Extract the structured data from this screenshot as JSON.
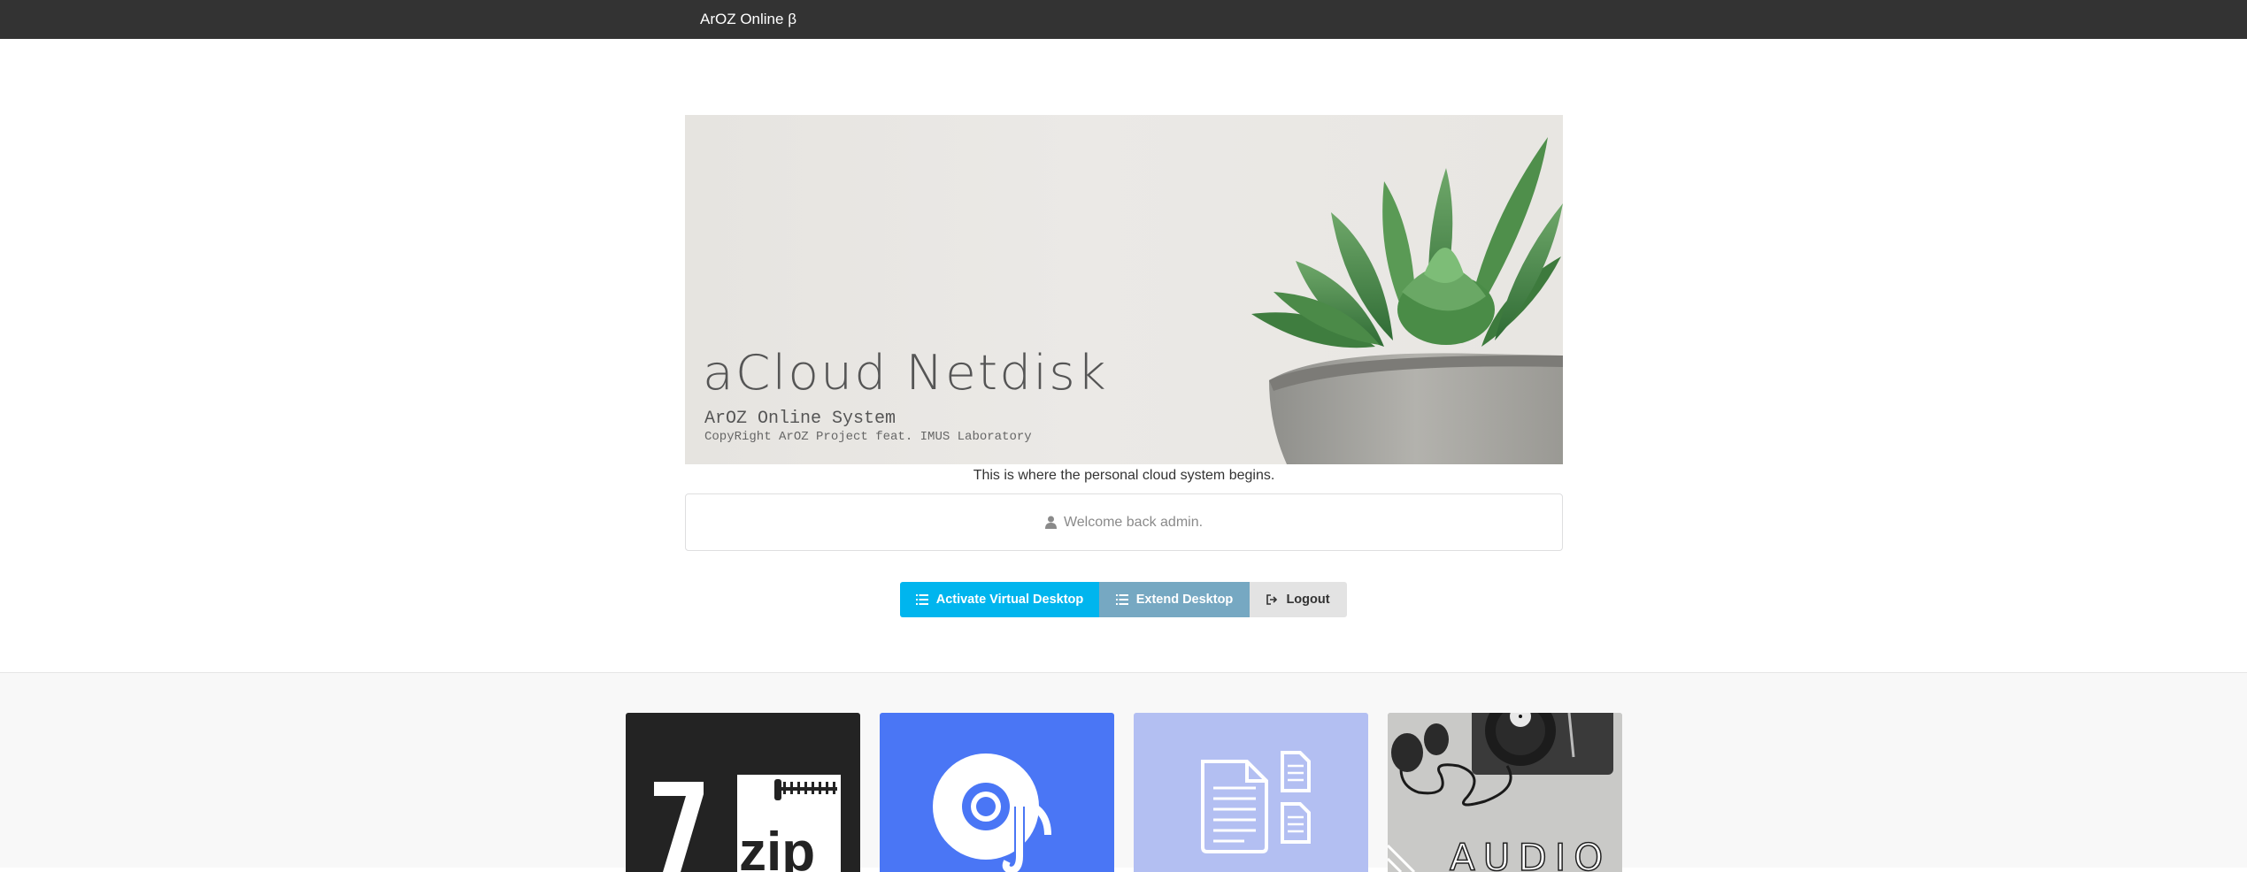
{
  "navbar": {
    "brand": "ArOZ Online β"
  },
  "banner": {
    "title": "aCloud Netdisk",
    "subtitle": "ArOZ Online System",
    "copyright": "CopyRight ArOZ Project feat. IMUS Laboratory"
  },
  "tagline": "This is where the personal cloud system begins.",
  "welcome": {
    "message": "Welcome back admin.",
    "icon": "user-icon"
  },
  "buttons": {
    "activate_label": "Activate Virtual Desktop",
    "extend_label": "Extend Desktop",
    "logout_label": "Logout",
    "activate_color": "#00b5ee",
    "extend_color": "#76a8c2",
    "logout_color": "#e3e3e3"
  },
  "apps": [
    {
      "name": "7zip",
      "icon": "7zip-icon",
      "text": "zip"
    },
    {
      "name": "Music Player",
      "icon": "music-disc-icon"
    },
    {
      "name": "Documents",
      "icon": "documents-icon"
    },
    {
      "name": "Audio",
      "icon": "turntable-icon",
      "text": "AUDIO"
    }
  ],
  "colors": {
    "navbar": "#333333",
    "app_music_bg": "#4a76f5",
    "app_docs_bg": "#b3bff2",
    "app_7zip_bg": "#232323"
  }
}
